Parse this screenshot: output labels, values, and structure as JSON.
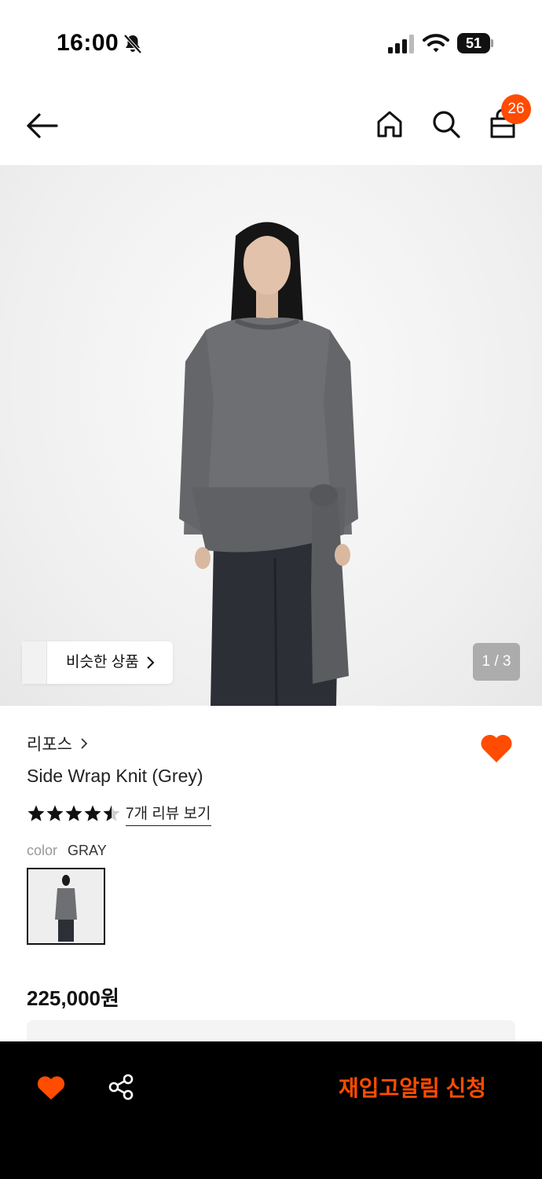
{
  "status_bar": {
    "time": "16:00",
    "battery": "51",
    "icons": [
      "bell-slash-icon",
      "signal-icon",
      "wifi-icon",
      "battery-icon"
    ]
  },
  "nav": {
    "icons": [
      "back-arrow-icon",
      "home-icon",
      "search-icon",
      "shopping-bag-icon"
    ],
    "cart_count": "26"
  },
  "hero": {
    "similar_label": "비슷한 상품",
    "page_indicator": "1 / 3"
  },
  "product": {
    "brand": "리포스",
    "title": "Side Wrap Knit (Grey)",
    "rating": 4.5,
    "rating_max": 5,
    "review_link": "7개 리뷰 보기",
    "color_label": "color",
    "color_value": "GRAY",
    "price": "225,000원",
    "wishlisted": true
  },
  "bottom_bar": {
    "icons": [
      "heart-icon",
      "share-icon"
    ],
    "restock_label": "재입고알림 신청"
  },
  "colors": {
    "accent": "#ff4c00",
    "bottom_bar_bg": "#000000"
  }
}
